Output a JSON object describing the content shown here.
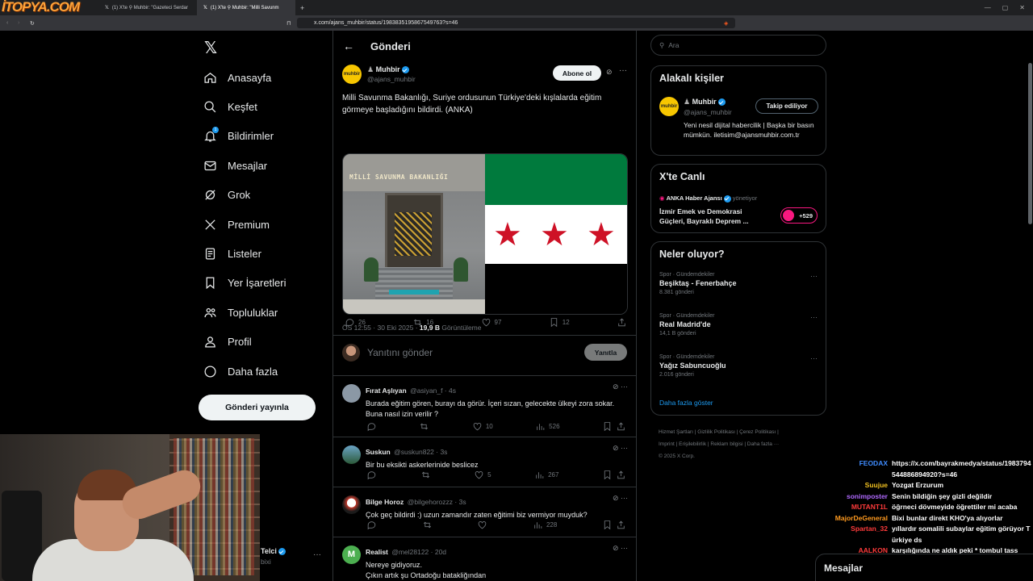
{
  "browser": {
    "tabs": [
      {
        "label": "(1) X'te ⚲ Muhbir: \"Gazeteci Serdar"
      },
      {
        "label": "(1) X'te ⚲ Muhbir: \"Milli Savunm"
      }
    ],
    "watermark": "İTOPYA.COM",
    "url": "x.com/ajans_muhbir/status/1983835195867549763?s=46"
  },
  "sidebar": {
    "items": [
      {
        "label": "Anasayfa",
        "icon": "home-icon"
      },
      {
        "label": "Keşfet",
        "icon": "search-icon"
      },
      {
        "label": "Bildirimler",
        "icon": "bell-icon",
        "badge": "1"
      },
      {
        "label": "Mesajlar",
        "icon": "mail-icon"
      },
      {
        "label": "Grok",
        "icon": "grok-icon"
      },
      {
        "label": "Premium",
        "icon": "x-icon"
      },
      {
        "label": "Listeler",
        "icon": "list-icon"
      },
      {
        "label": "Yer İşaretleri",
        "icon": "bookmark-icon"
      },
      {
        "label": "Topluluklar",
        "icon": "people-icon"
      },
      {
        "label": "Profil",
        "icon": "user-icon"
      },
      {
        "label": "Daha fazla",
        "icon": "more-icon"
      }
    ],
    "post_button": "Gönderi yayınla",
    "account_name": "Telci",
    "account_handle": "bixi"
  },
  "main": {
    "title": "Gönderi",
    "tweet": {
      "author": "Muhbir",
      "handle": "@ajans_muhbir",
      "subscribe": "Abone ol",
      "text": "Milli Savunma Bakanlığı, Suriye ordusunun Türkiye'deki kışlalarda eğitim görmeye başladığını bildirdi. (ANKA)",
      "image_sign": "MİLLİ SAVUNMA BAKANLIĞI",
      "time": "ÖS 12:55 · 30 Eki 2025 · ",
      "views": "19,9 B",
      "views_label": "Görüntüleme",
      "stats": {
        "replies": "26",
        "reposts": "16",
        "likes": "97",
        "bookmarks": "12"
      }
    },
    "compose": {
      "placeholder": "Yanıtını gönder",
      "button": "Yanıtla"
    },
    "replies": [
      {
        "name": "Fırat Aşlıyan",
        "handle": "@asiyan_f · 4s",
        "text": "Burada eğitim gören, burayı da görür. İçeri sızan, gelecekte ülkeyi zora sokar. Buna nasıl izin verilir ?",
        "likes": "10",
        "views": "526"
      },
      {
        "name": "Suskun",
        "handle": "@suskun822 · 3s",
        "text": "Bir bu eksikti askerlerinide beslicez",
        "likes": "5",
        "views": "267"
      },
      {
        "name": "Bilge Horoz",
        "handle": "@bilgehorozzz · 3s",
        "text": "Çok geç bildirdi :) uzun zamandır zaten eğitimi biz vermiyor muyduk?",
        "likes": "",
        "views": "228"
      },
      {
        "name": "Realist",
        "handle": "@mel28122 · 20d",
        "text": "Nereye gidiyoruz.\nÇıkın artık şu Ortadoğu batakliğından",
        "likes": "",
        "views": ""
      }
    ]
  },
  "right": {
    "search_placeholder": "Ara",
    "related": {
      "title": "Alakalı kişiler",
      "name": "Muhbir",
      "handle": "@ajans_muhbir",
      "button": "Takip ediliyor",
      "bio": "Yeni nesil dijital habercilik | Başka bir basın mümkün. iletisim@ajansmuhbir.com.tr"
    },
    "live": {
      "title": "X'te Canlı",
      "host": "ANKA Haber Ajansı",
      "host_role": "yönetiyor",
      "text": "İzmir Emek ve Demokrasi Güçleri, Bayraklı Deprem ...",
      "count": "+529"
    },
    "trends": {
      "title": "Neler oluyor?",
      "items": [
        {
          "cat": "Spor · Gündemdekiler",
          "topic": "Beşiktaş - Fenerbahçe",
          "count": "8.381 gönderi"
        },
        {
          "cat": "Spor · Gündemdekiler",
          "topic": "Real Madrid'de",
          "count": "14,1 B gönderi"
        },
        {
          "cat": "Spor · Gündemdekiler",
          "topic": "Yağız Sabuncuoğlu",
          "count": "2.016 gönderi"
        }
      ],
      "more": "Daha fazla göster"
    },
    "footer": {
      "line1": "Hizmet Şartları  |  Gizlilik Politikası  |  Çerez Politikası  |",
      "line2": "Imprint  |  Erişilebilirlik  |  Reklam bilgisi  |  Daha fazla ···",
      "line3": "© 2025 X Corp."
    }
  },
  "chat": [
    {
      "user": "FEODAX",
      "color": "#3f8cff",
      "msg": "https://x.com/bayrakmedya/status/1983794544886894920?s=46"
    },
    {
      "user": "Suujue",
      "color": "#f0c020",
      "msg": "Yozgat Erzurum"
    },
    {
      "user": "sonimposter",
      "color": "#b06aff",
      "msg": "Senin bildiğin şey gizli değildir"
    },
    {
      "user": "MUTANT1L",
      "color": "#ff3b3b",
      "msg": "öğrneci dövmeyide öğrettiler mi acaba"
    },
    {
      "user": "MajorDeGeneral",
      "color": "#ff9a1f",
      "msg": "Bixi bunlar direkt KHO'ya alıyorlar"
    },
    {
      "user": "Spartan_32",
      "color": "#ff3b3b",
      "msg": "yıllardır somalili subaylar eğitim görüyor Türkiye ds"
    },
    {
      "user": "AALKON",
      "color": "#ff3b3b",
      "msg": "karşılığında ne aldık peki * tombul tass"
    }
  ],
  "dm_label": "Mesajlar"
}
